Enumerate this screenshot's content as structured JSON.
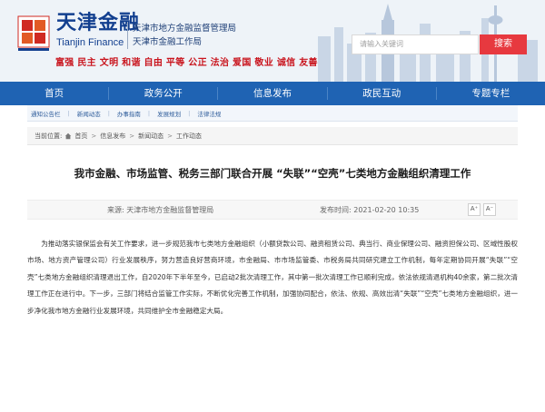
{
  "header": {
    "logo_cn": "天津金融",
    "logo_en": "Tianjin Finance",
    "org_line1": "天津市地方金融监督管理局",
    "org_line2": "天津市金融工作局",
    "values": "富强 民主 文明 和谐 自由 平等 公正 法治 爱国 敬业 诚信 友善",
    "search_placeholder": "请输入关键词",
    "search_button": "搜索",
    "accent_color": "#e7393f",
    "brand_color": "#1f63b3"
  },
  "nav": {
    "items": [
      "首页",
      "政务公开",
      "信息发布",
      "政民互动",
      "专题专栏"
    ]
  },
  "subnav": {
    "items": [
      "通知公告栏",
      "新闻动态",
      "办事指南",
      "发展规划",
      "法律法规"
    ]
  },
  "breadcrumb": {
    "label": "当前位置:",
    "items": [
      "首页",
      "信息发布",
      "新闻动态",
      "工作动态"
    ]
  },
  "article": {
    "title": "我市金融、市场监管、税务三部门联合开展 “失联”“空壳”七类地方金融组织清理工作",
    "source": "来源:  天津市地方金融监督管理局",
    "time": "发布时间:  2021-02-20 10:35",
    "font_large": "A⁺",
    "font_small": "A⁻",
    "body": "为推动落实银保监会有关工作要求，进一步规范我市七类地方金融组织（小额贷款公司、融资租赁公司、典当行、商业保理公司、融资担保公司、区域性股权市场、地方资产管理公司）行业发展秩序，努力营造良好营商环境，市金融局、市市场监管委、市税务局共同研究建立工作机制，每年定期协同开展“失联”“空壳”七类地方金融组织清理退出工作，自2020年下半年至今，已启动2批次清理工作，其中第一批次清理工作已顺利完成，依法依规清退机构40余家，第二批次清理工作正在进行中。下一步，三部门将结合监管工作实际，不断优化完善工作机制，加强协同配合，依法、依规、高效出清“失联”“空壳”七类地方金融组织，进一步净化我市地方金融行业发展环境，共同维护全市金融稳定大局。"
  }
}
